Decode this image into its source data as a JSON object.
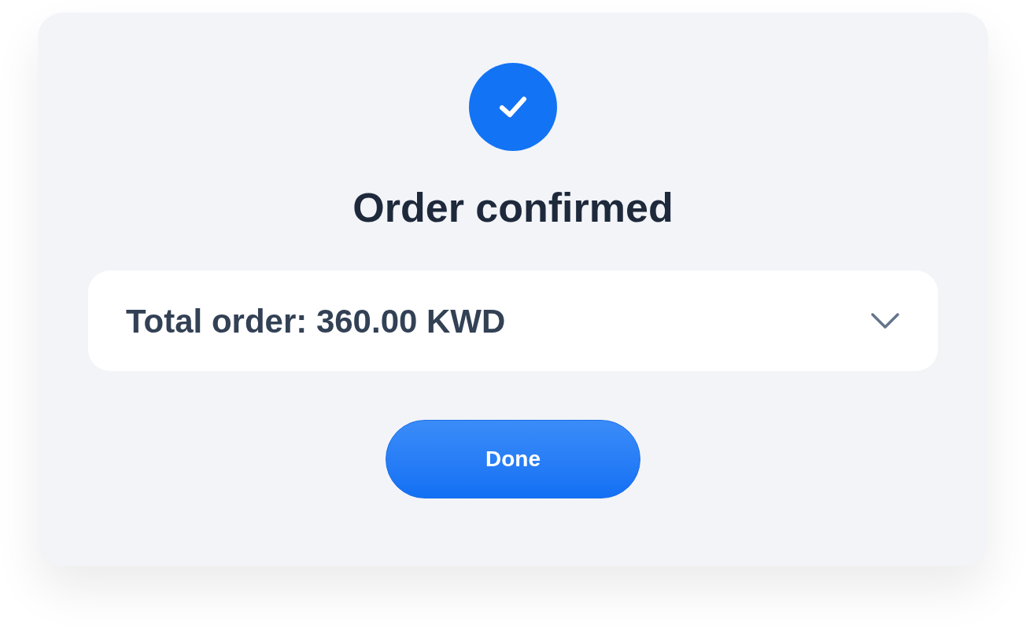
{
  "dialog": {
    "title": "Order confirmed",
    "summary": {
      "label": "Total order: 360.00 KWD",
      "expanded": false
    },
    "button": "Done"
  }
}
